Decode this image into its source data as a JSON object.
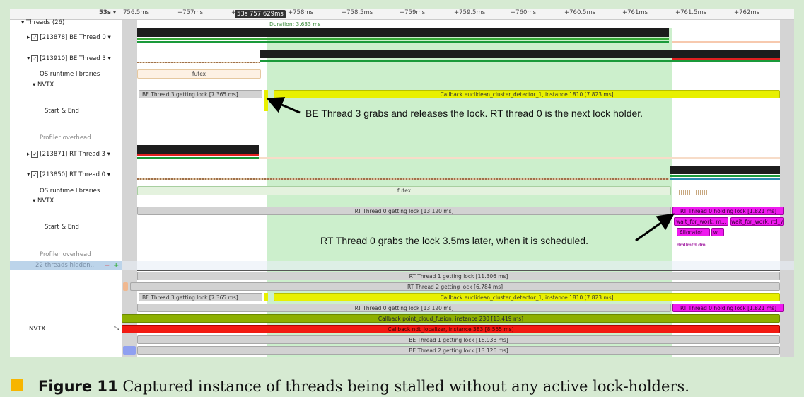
{
  "timeline": {
    "origin_label": "53s ▾",
    "cursor_label": "53s 757.629ms",
    "ticks": [
      "756.5ms",
      "+757ms",
      "+",
      "+758ms",
      "+758.5ms",
      "+759ms",
      "+759.5ms",
      "+760ms",
      "+760.5ms",
      "+761ms",
      "+761.5ms",
      "+762ms"
    ],
    "duration_label": "Duration: 3.633 ms"
  },
  "tree": {
    "threads_header": "Threads (26)",
    "be_thread0": "[213878] BE Thread 0 ▾",
    "be_thread3": "[213910] BE Thread 3 ▾",
    "os_runtime_1": "OS runtime libraries",
    "nvtx_1": "NVTX",
    "start_end_1": "Start & End",
    "profiler_overhead_1": "Profiler overhead",
    "rt_thread3": "[213871] RT Thread 3 ▾",
    "rt_thread0": "[213850] RT Thread 0 ▾",
    "os_runtime_2": "OS runtime libraries",
    "nvtx_2": "NVTX",
    "start_end_2": "Start & End",
    "profiler_overhead_2": "Profiler overhead",
    "hidden_threads": "22 threads hidden...",
    "hidden_minus": "−",
    "hidden_plus": "+",
    "nvtx_summary": "NVTX"
  },
  "bars": {
    "futex1": "futex",
    "be3_lock": "BE Thread 3 getting lock [7.365 ms]",
    "callback_euclid": "Callback euclidean_cluster_detector_1, instance 1810 [7.823 ms]",
    "futex2": "futex",
    "rt0_lock": "RT Thread 0 getting lock [13.120 ms]",
    "rt0_hold": "RT Thread 0 holding lock [1.821 ms]",
    "wait1": "wait_for_work: m...",
    "wait2": "wait_for_work: rcl_w...",
    "alloc": "Allocator...",
    "wsmall": "w...",
    "profiler_text": "dmllmtd  dm",
    "sum_rt1": "RT Thread 1 getting lock [11.306 ms]",
    "sum_rt2": "RT Thread 2 getting lock [6.784 ms]",
    "sum_be3": "BE Thread 3 getting lock [7.365 ms]",
    "sum_callback": "Callback euclidean_cluster_detector_1, instance 1810 [7.823 ms]",
    "sum_rt0": "RT Thread 0 getting lock [13.120 ms]",
    "sum_rt0_hold": "RT Thread 0 holding lock [1.821 ms]",
    "sum_pcf": "Callback point_cloud_fusion, instance 230 [13.419 ms]",
    "sum_ndt": "Callback ndt_localizer, instance 383 [8.555 ms]",
    "sum_be1": "BE Thread 1 getting lock [18.938 ms]",
    "sum_be2": "BE Thread 2 getting lock [13.126 ms]"
  },
  "annotations": {
    "be3_note": "BE Thread 3 grabs and releases the lock. RT thread 0 is the next lock holder.",
    "rt0_note": "RT Thread 0 grabs the lock 3.5ms later, when it is scheduled."
  },
  "caption": {
    "label": "Figure 11",
    "text": " Captured instance of threads being stalled without any active lock-holders."
  },
  "colors": {
    "highlight": "#ccefcc",
    "lock_gray": "#d2d2d2",
    "callback_yellow": "#e8f000",
    "holding_magenta": "#ef1aef",
    "caption_square": "#f7b500"
  }
}
